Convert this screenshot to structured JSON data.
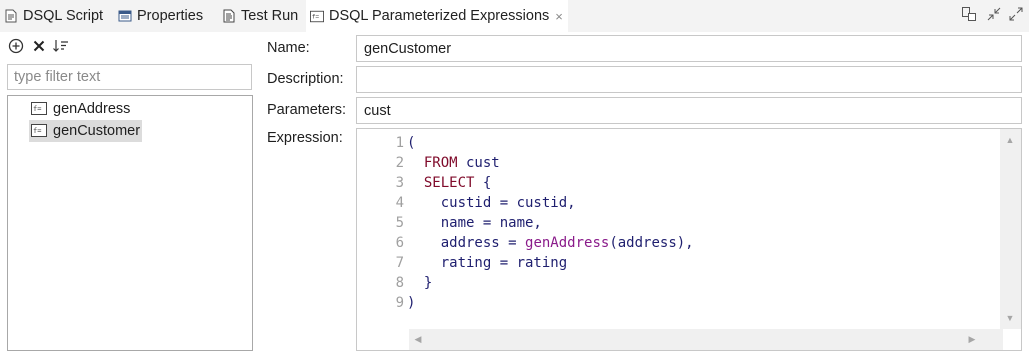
{
  "tabs": [
    {
      "label": "DSQL Script",
      "icon": "script-icon"
    },
    {
      "label": "Properties",
      "icon": "properties-icon"
    },
    {
      "label": "Test Run",
      "icon": "test-run-icon"
    },
    {
      "label": "DSQL Parameterized Expressions",
      "icon": "expression-icon",
      "active": true,
      "close": "×"
    }
  ],
  "window_controls": [
    "restore-icon",
    "minimize-icon",
    "maximize-icon"
  ],
  "left": {
    "filter_placeholder": "type filter text",
    "items": [
      {
        "label": "genAddress",
        "selected": false
      },
      {
        "label": "genCustomer",
        "selected": true
      }
    ]
  },
  "form": {
    "name_label": "Name:",
    "name_value": "genCustomer",
    "description_label": "Description:",
    "description_value": "",
    "parameters_label": "Parameters:",
    "parameters_value": "cust",
    "expression_label": "Expression:"
  },
  "code": {
    "line_numbers": [
      "1",
      "2",
      "3",
      "4",
      "5",
      "6",
      "7",
      "8",
      "9"
    ],
    "lines": [
      [
        {
          "t": "(",
          "c": "src"
        }
      ],
      [
        {
          "t": "  ",
          "c": "src"
        },
        {
          "t": "FROM",
          "c": "kw"
        },
        {
          "t": " cust",
          "c": "src"
        }
      ],
      [
        {
          "t": "  ",
          "c": "src"
        },
        {
          "t": "SELECT",
          "c": "kw"
        },
        {
          "t": " {",
          "c": "src"
        }
      ],
      [
        {
          "t": "    custid = custid,",
          "c": "src"
        }
      ],
      [
        {
          "t": "    name = name,",
          "c": "src"
        }
      ],
      [
        {
          "t": "    address = ",
          "c": "src"
        },
        {
          "t": "genAddress",
          "c": "fn"
        },
        {
          "t": "(address),",
          "c": "src"
        }
      ],
      [
        {
          "t": "    rating = rating",
          "c": "src"
        }
      ],
      [
        {
          "t": "  }",
          "c": "src"
        }
      ],
      [
        {
          "t": ")",
          "c": "src"
        }
      ]
    ]
  },
  "colors": {
    "keyword": "#7f0a2a",
    "function": "#8a1b8a",
    "identifier": "#1f1f6f",
    "selection": "#dcdcdc"
  }
}
